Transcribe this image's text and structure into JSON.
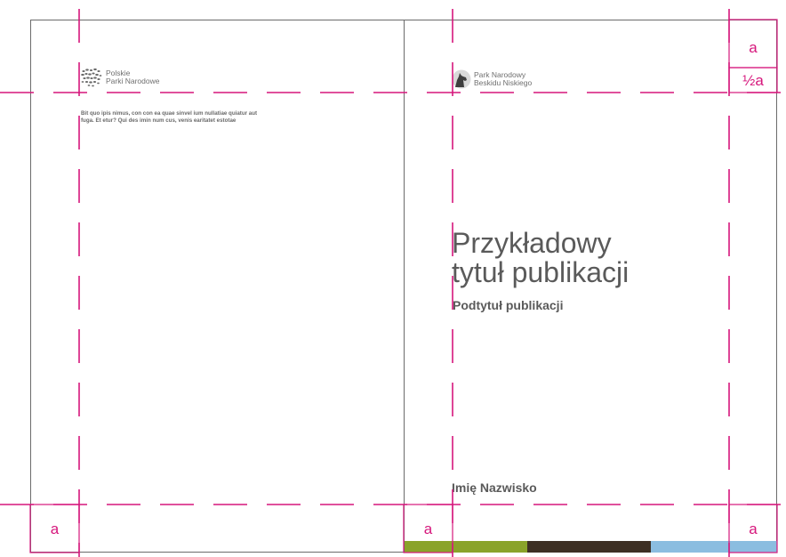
{
  "left_page": {
    "logo": {
      "icon": "leaf-cluster-icon",
      "text": "Polskie\nParki Narodowe"
    },
    "body_text": "Bit quo ipis nimus, con con ea quae sinvel ium nullatiae quiatur aut fuga. Et etur? Qui des imin num cus, venis earitatet estotae"
  },
  "right_page": {
    "logo": {
      "icon": "wolf-icon",
      "text": "Park Narodowy\nBeskidu Niskiego"
    },
    "title": "Przykładowy\ntytuł publikacji",
    "subtitle": "Podtytuł publikacji",
    "author": "Imię Nazwisko",
    "color_bar": [
      {
        "color": "#8aa32a",
        "share": 0.33
      },
      {
        "color": "#3d2f24",
        "share": 0.33
      },
      {
        "color": "#8bbde0",
        "share": 0.34
      }
    ]
  },
  "guides": {
    "color": "#d6177c",
    "label_a": "a",
    "label_half_a": "½a"
  }
}
